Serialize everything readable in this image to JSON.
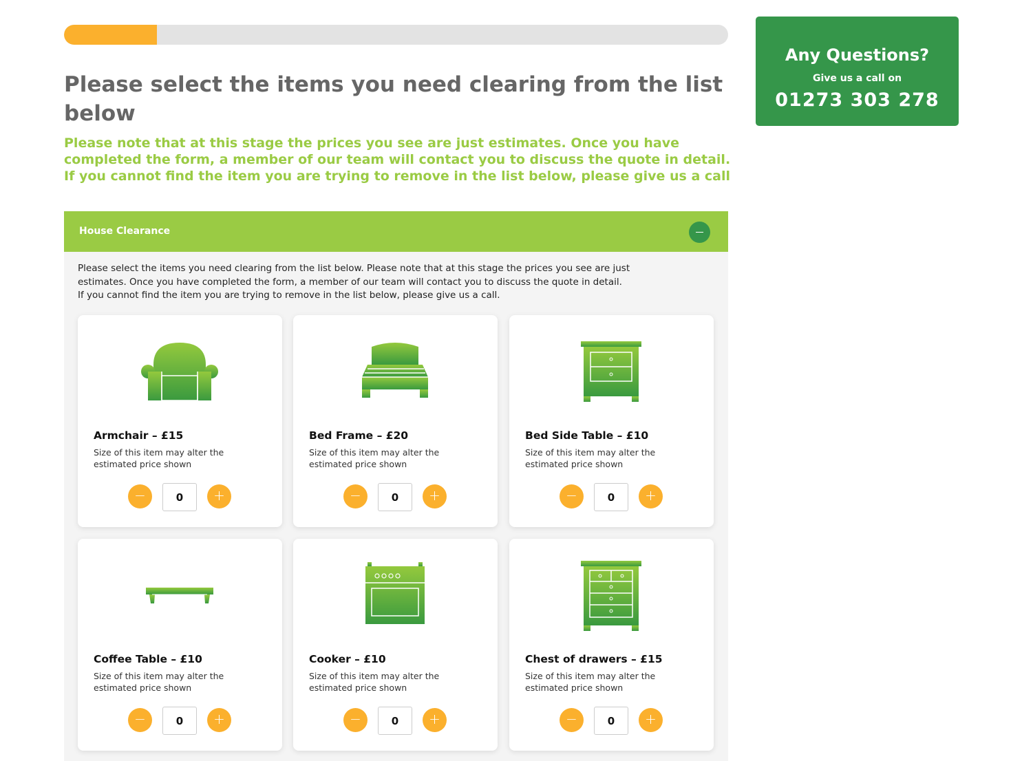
{
  "progress": {
    "percent": 14
  },
  "heading": "Please select the items you need clearing from the list below",
  "notice_lines": [
    "Please note that at this stage the prices you see are just estimates. Once you have",
    "completed the form, a member of our team will contact you to discuss the quote in detail.",
    "If you cannot find the item you are trying to remove in the list below, please give us a call"
  ],
  "section": {
    "title": "House Clearance",
    "intro_lines": [
      "Please select the items you need clearing from the list below. Please note that at this stage the prices you see are just",
      "estimates. Once you have completed the form, a member of our team will contact you to discuss the quote in detail.",
      "If you cannot find the item you are trying to remove in the list below, please give us a call."
    ],
    "items": [
      {
        "title": "Armchair – £15",
        "note": "Size of this item may alter the estimated price shown",
        "qty": "0",
        "icon": "armchair-icon"
      },
      {
        "title": "Bed Frame – £20",
        "note": "Size of this item may alter the estimated price shown",
        "qty": "0",
        "icon": "bed-frame-icon"
      },
      {
        "title": "Bed Side Table – £10",
        "note": "Size of this item may alter the estimated price shown",
        "qty": "0",
        "icon": "bedside-table-icon"
      },
      {
        "title": "Coffee Table – £10",
        "note": "Size of this item may alter the estimated price shown",
        "qty": "0",
        "icon": "coffee-table-icon"
      },
      {
        "title": "Cooker – £10",
        "note": "Size of this item may alter the estimated price shown",
        "qty": "0",
        "icon": "cooker-icon"
      },
      {
        "title": "Chest of drawers – £15",
        "note": "Size of this item may alter the estimated price shown",
        "qty": "0",
        "icon": "chest-of-drawers-icon"
      }
    ]
  },
  "help": {
    "title": "Any Questions?",
    "subtitle": "Give us a call on",
    "phone": "01273 303 278"
  },
  "colors": {
    "accent": "#9acb44",
    "dark_green": "#35964a",
    "orange": "#fbb02d",
    "heading": "#666666"
  }
}
